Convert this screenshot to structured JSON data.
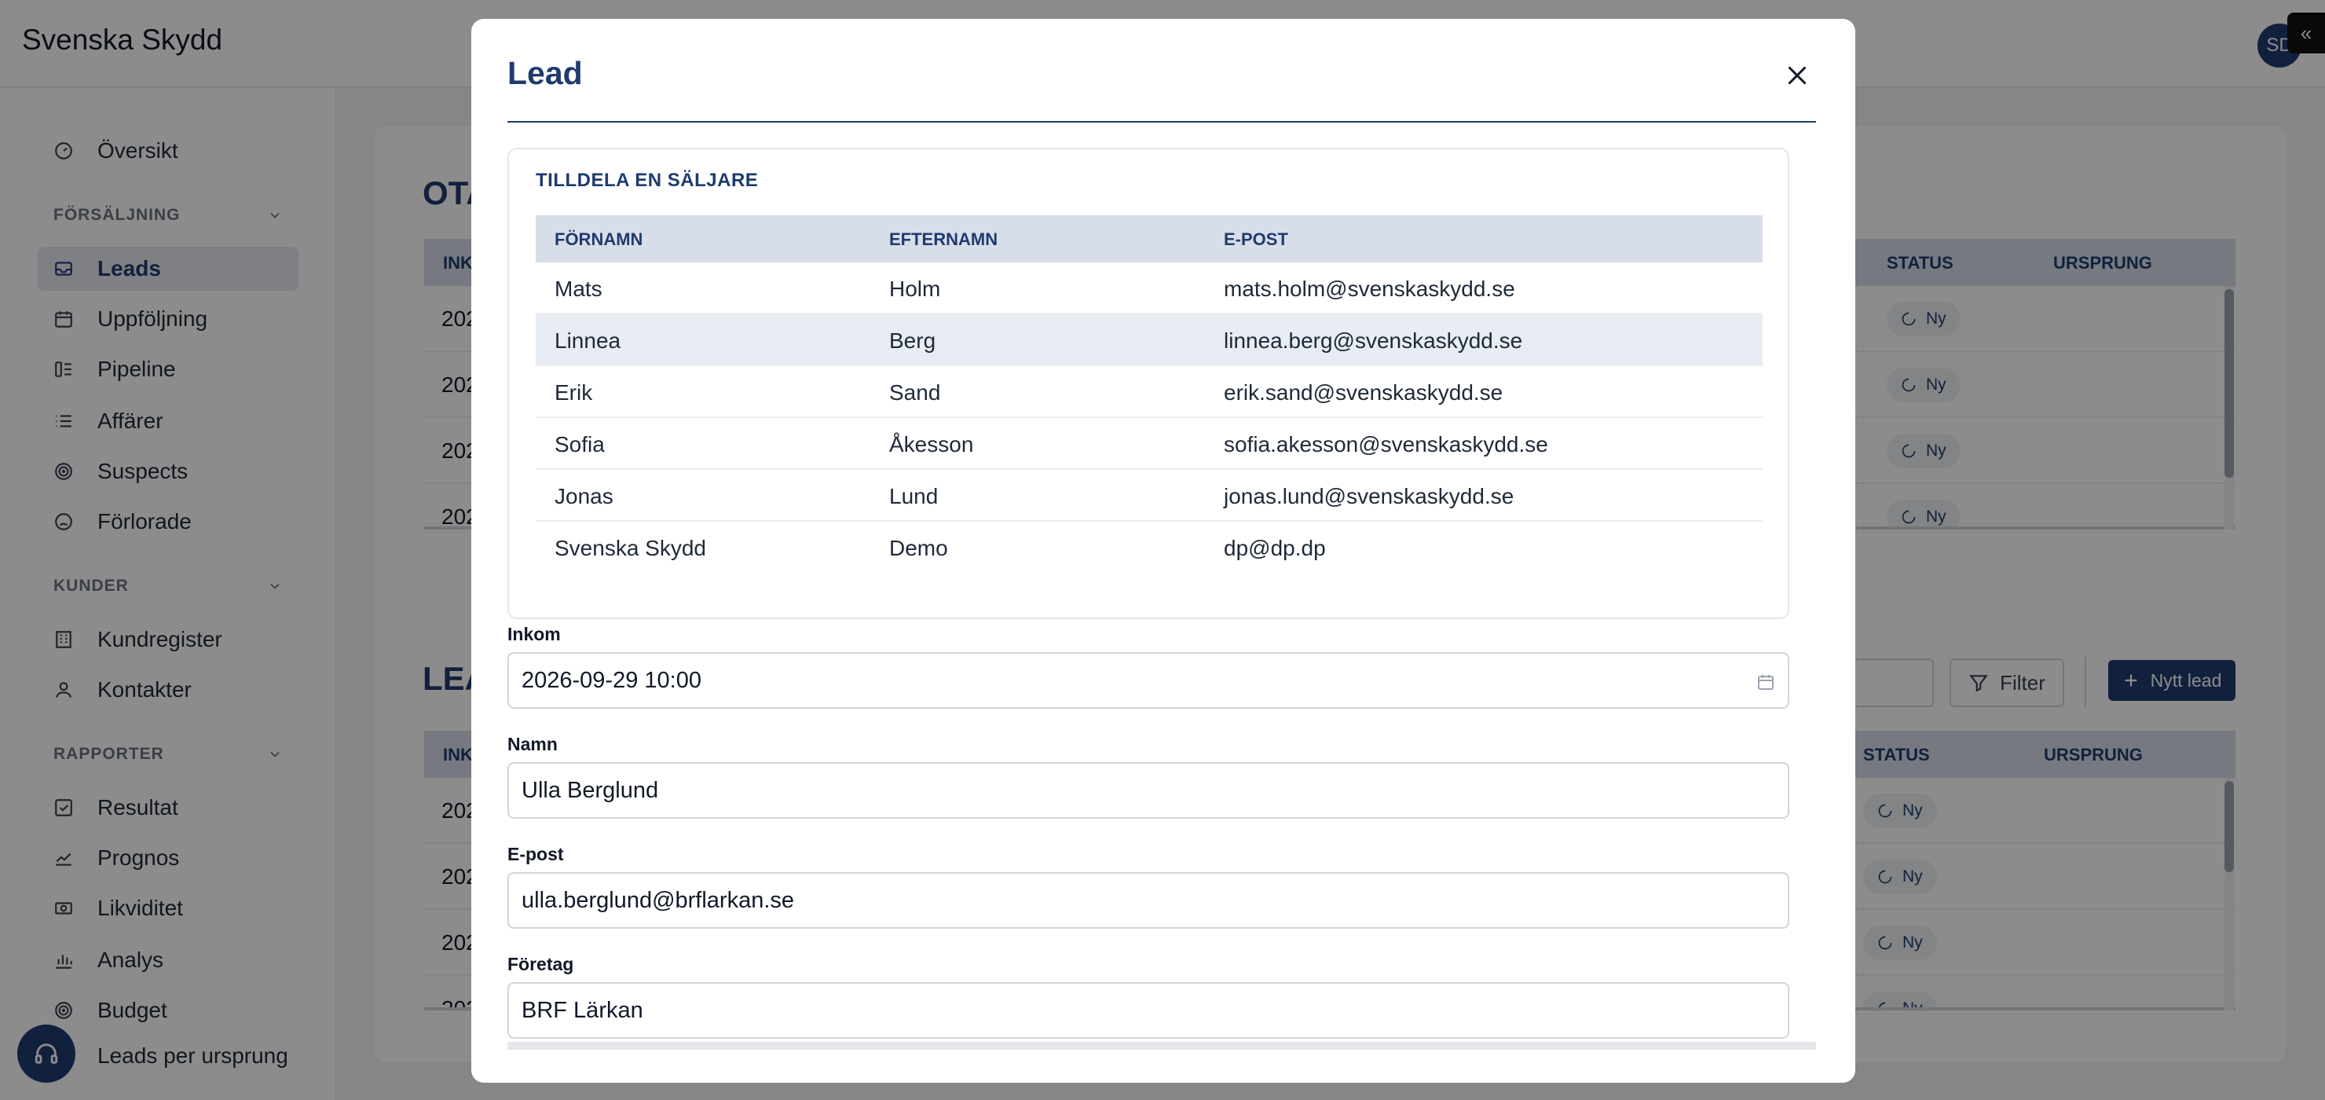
{
  "app": {
    "title": "Svenska Skydd",
    "avatar_initials": "SD",
    "collapse_glyph": "«"
  },
  "sidebar": {
    "items_top": [
      {
        "label": "Översikt",
        "icon": "gauge-icon"
      }
    ],
    "sections": [
      {
        "label": "FÖRSÄLJNING",
        "items": [
          {
            "label": "Leads",
            "icon": "inbox-icon",
            "active": true
          },
          {
            "label": "Uppföljning",
            "icon": "calendar-icon"
          },
          {
            "label": "Pipeline",
            "icon": "pipeline-icon"
          },
          {
            "label": "Affärer",
            "icon": "list-icon"
          },
          {
            "label": "Suspects",
            "icon": "target-icon"
          },
          {
            "label": "Förlorade",
            "icon": "sad-face-icon"
          }
        ]
      },
      {
        "label": "KUNDER",
        "items": [
          {
            "label": "Kundregister",
            "icon": "building-icon"
          },
          {
            "label": "Kontakter",
            "icon": "user-icon"
          }
        ]
      },
      {
        "label": "RAPPORTER",
        "items": [
          {
            "label": "Resultat",
            "icon": "checkbox-icon"
          },
          {
            "label": "Prognos",
            "icon": "trend-icon"
          },
          {
            "label": "Likviditet",
            "icon": "cash-icon"
          },
          {
            "label": "Analys",
            "icon": "bar-chart-icon"
          },
          {
            "label": "Budget",
            "icon": "target-icon"
          },
          {
            "label": "Leads per ursprung",
            "icon": "chart-icon"
          }
        ]
      }
    ]
  },
  "background": {
    "card1": {
      "title_fragment": "OTA",
      "columns": {
        "first": "INK",
        "status": "STATUS",
        "origin": "URSPRUNG"
      },
      "row_fragment": "202",
      "status": "Ny"
    },
    "card2": {
      "title_fragment": "LEA",
      "columns": {
        "first": "INK",
        "status": "STATUS",
        "origin": "URSPRUNG"
      },
      "row_fragment": "202",
      "status": "Ny",
      "filter_label": "Filter",
      "new_lead_label": "Nytt lead"
    }
  },
  "modal": {
    "title": "Lead",
    "assign": {
      "title": "TILLDELA EN SÄLJARE",
      "columns": [
        "FÖRNAMN",
        "EFTERNAMN",
        "E-POST"
      ],
      "rows": [
        [
          "Mats",
          "Holm",
          "mats.holm@svenskaskydd.se"
        ],
        [
          "Linnea",
          "Berg",
          "linnea.berg@svenskaskydd.se"
        ],
        [
          "Erik",
          "Sand",
          "erik.sand@svenskaskydd.se"
        ],
        [
          "Sofia",
          "Åkesson",
          "sofia.akesson@svenskaskydd.se"
        ],
        [
          "Jonas",
          "Lund",
          "jonas.lund@svenskaskydd.se"
        ],
        [
          "Svenska Skydd",
          "Demo",
          "dp@dp.dp"
        ]
      ],
      "highlighted_row": 1
    },
    "fields": [
      {
        "label": "Inkom",
        "value": "2026-09-29 10:00",
        "type": "datetime"
      },
      {
        "label": "Namn",
        "value": "Ulla Berglund",
        "type": "text"
      },
      {
        "label": "E-post",
        "value": "ulla.berglund@brflarkan.se",
        "type": "email"
      },
      {
        "label": "Företag",
        "value": "BRF Lärkan",
        "type": "text"
      }
    ]
  },
  "colors": {
    "brand": "#1f3b6e",
    "table_header": "#d8dee9",
    "active_nav": "#e5e9f0"
  }
}
